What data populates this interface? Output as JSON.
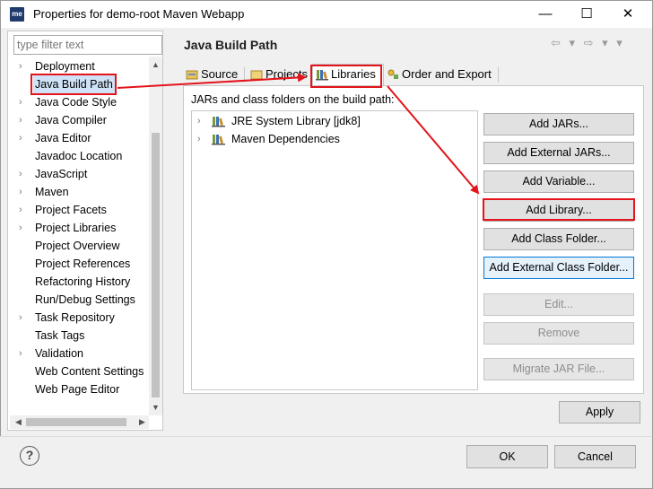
{
  "window": {
    "app_icon": "me",
    "title": "Properties for demo-root Maven Webapp",
    "min_glyph": "—",
    "max_glyph": "☐",
    "close_glyph": "✕"
  },
  "sidebar": {
    "filter_placeholder": "type filter text",
    "items": [
      {
        "label": "Deployment",
        "expandable": true
      },
      {
        "label": "Java Build Path",
        "expandable": false,
        "selected": true
      },
      {
        "label": "Java Code Style",
        "expandable": true
      },
      {
        "label": "Java Compiler",
        "expandable": true
      },
      {
        "label": "Java Editor",
        "expandable": true
      },
      {
        "label": "Javadoc Location",
        "expandable": false
      },
      {
        "label": "JavaScript",
        "expandable": true
      },
      {
        "label": "Maven",
        "expandable": true
      },
      {
        "label": "Project Facets",
        "expandable": true
      },
      {
        "label": "Project Libraries",
        "expandable": true
      },
      {
        "label": "Project Overview",
        "expandable": false
      },
      {
        "label": "Project References",
        "expandable": false
      },
      {
        "label": "Refactoring History",
        "expandable": false
      },
      {
        "label": "Run/Debug Settings",
        "expandable": false
      },
      {
        "label": "Task Repository",
        "expandable": true
      },
      {
        "label": "Task Tags",
        "expandable": false
      },
      {
        "label": "Validation",
        "expandable": true
      },
      {
        "label": "Web Content Settings",
        "expandable": false
      },
      {
        "label": "Web Page Editor",
        "expandable": false
      }
    ]
  },
  "main": {
    "title": "Java Build Path",
    "nav_glyphs": "⇦ ▾ ⇨ ▾ ▾",
    "tabs": [
      {
        "label": "Source",
        "icon": "source-folder-icon"
      },
      {
        "label": "Projects",
        "icon": "projects-folder-icon"
      },
      {
        "label": "Libraries",
        "icon": "libraries-icon",
        "active": true
      },
      {
        "label": "Order and Export",
        "icon": "order-export-icon"
      }
    ],
    "section_label": "JARs and class folders on the build path:",
    "libraries": [
      {
        "label": "JRE System Library [jdk8]"
      },
      {
        "label": "Maven Dependencies"
      }
    ],
    "buttons": {
      "add_jars": "Add JARs...",
      "add_external_jars": "Add External JARs...",
      "add_variable": "Add Variable...",
      "add_library": "Add Library...",
      "add_class_folder": "Add Class Folder...",
      "add_external_class_folder": "Add External Class Folder...",
      "edit": "Edit...",
      "remove": "Remove",
      "migrate_jar": "Migrate JAR File..."
    },
    "apply": "Apply"
  },
  "footer": {
    "help": "?",
    "ok": "OK",
    "cancel": "Cancel"
  },
  "colors": {
    "annotation_red": "#e3141b",
    "selection": "#cfe2f7",
    "focus_blue": "#0078d7"
  }
}
